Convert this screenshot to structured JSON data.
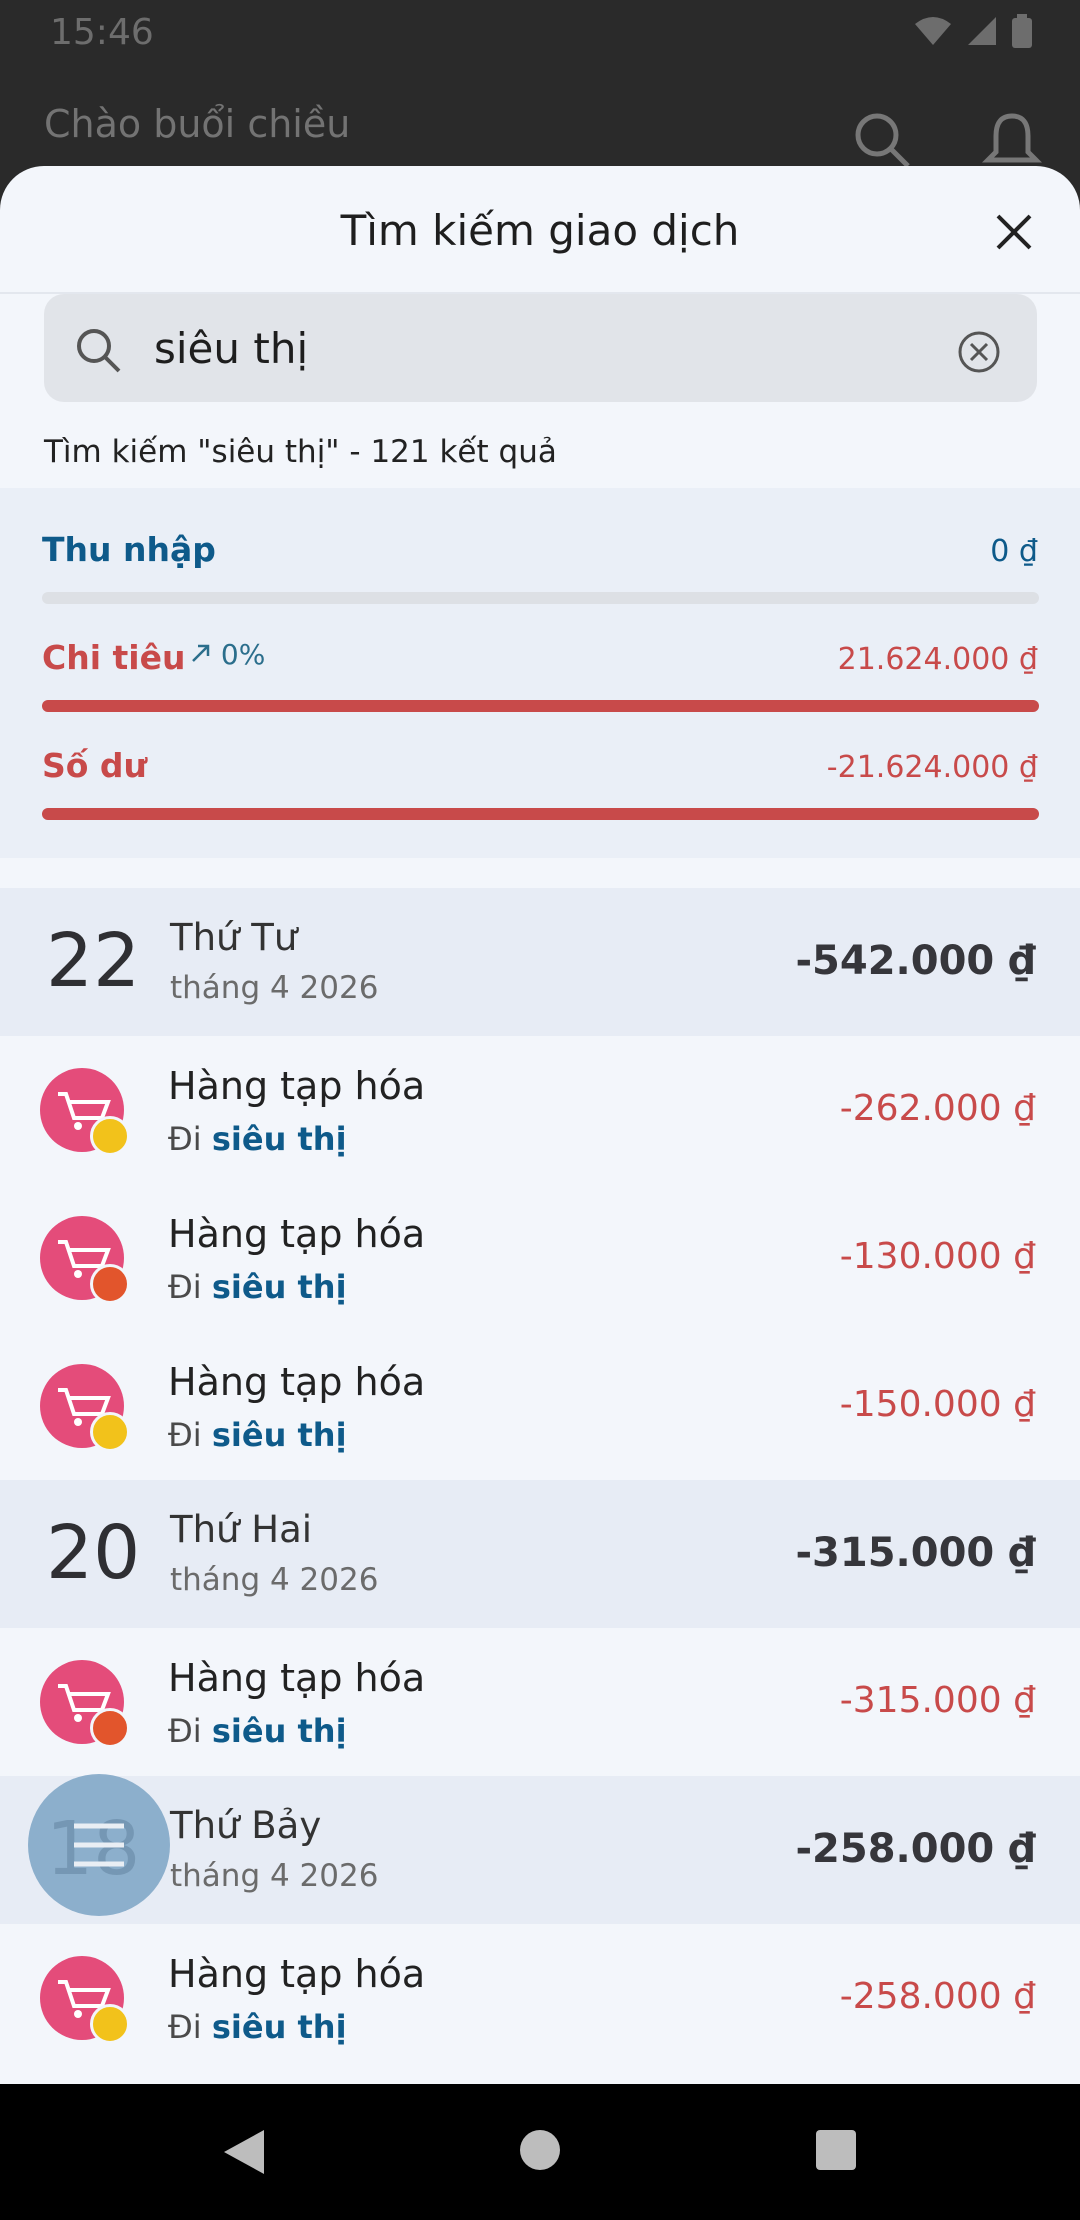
{
  "status": {
    "time": "15:46"
  },
  "header": {
    "greeting": "Chào buổi chiều"
  },
  "sheet": {
    "title": "Tìm kiếm giao dịch",
    "search": {
      "value": "siêu thị",
      "placeholder": ""
    },
    "result_text": "Tìm kiếm \"siêu thị\" - 121 kết quả"
  },
  "summary": {
    "income_label": "Thu nhập",
    "income_value": "0 ₫",
    "income_fill": 0,
    "expense_label": "Chi tiêu",
    "expense_trend": "0%",
    "expense_value": "21.624.000 ₫",
    "expense_fill": 1,
    "balance_label": "Số dư",
    "balance_value": "-21.624.000 ₫",
    "balance_fill": 1
  },
  "groups": [
    {
      "day": "22",
      "weekday": "Thứ Tư",
      "month": "tháng 4 2026",
      "total": "-542.000 ₫",
      "items": [
        {
          "title": "Hàng tạp hóa",
          "note_prefix": "Đi",
          "note_highlight": "siêu thị",
          "amount": "-262.000 ₫",
          "badge": "cash-icon",
          "badge_color": "#f2c21b"
        },
        {
          "title": "Hàng tạp hóa",
          "note_prefix": "Đi",
          "note_highlight": "siêu thị",
          "amount": "-130.000 ₫",
          "badge": "wallet-icon",
          "badge_color": "#e2552c"
        },
        {
          "title": "Hàng tạp hóa",
          "note_prefix": "Đi",
          "note_highlight": "siêu thị",
          "amount": "-150.000 ₫",
          "badge": "coin-icon",
          "badge_color": "#f2c21b"
        }
      ]
    },
    {
      "day": "20",
      "weekday": "Thứ Hai",
      "month": "tháng 4 2026",
      "total": "-315.000 ₫",
      "items": [
        {
          "title": "Hàng tạp hóa",
          "note_prefix": "Đi",
          "note_highlight": "siêu thị",
          "amount": "-315.000 ₫",
          "badge": "wallet-icon",
          "badge_color": "#e2552c"
        }
      ]
    },
    {
      "day": "18",
      "weekday": "Thứ Bảy",
      "month": "tháng 4 2026",
      "total": "-258.000 ₫",
      "items": [
        {
          "title": "Hàng tạp hóa",
          "note_prefix": "Đi",
          "note_highlight": "siêu thị",
          "amount": "-258.000 ₫",
          "badge": "coin-icon",
          "badge_color": "#f2c21b"
        }
      ]
    }
  ],
  "colors": {
    "income": "#0e5a8a",
    "expense": "#c84a4a",
    "cart_bg": "#e44c7a"
  }
}
